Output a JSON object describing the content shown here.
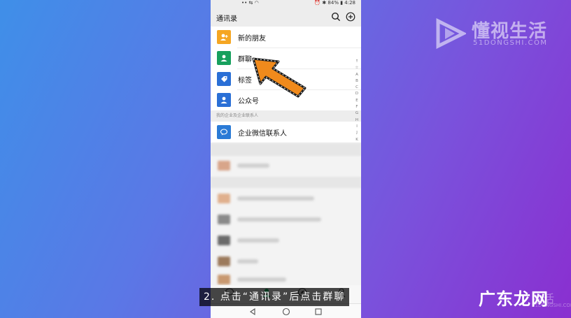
{
  "status_bar": {
    "left": "•• ⇆ ◠",
    "right": "⏰ ✱ 84% ▮ 4:28"
  },
  "header": {
    "title": "通讯录"
  },
  "contacts_menu": {
    "items": [
      {
        "label": "新的朋友",
        "icon": "add-friend-icon",
        "color": "#f5a623"
      },
      {
        "label": "群聊",
        "icon": "group-icon",
        "color": "#17a05d"
      },
      {
        "label": "标签",
        "icon": "tag-icon",
        "color": "#2a6fd6"
      },
      {
        "label": "公众号",
        "icon": "official-account-icon",
        "color": "#2a6fd6"
      }
    ]
  },
  "enterprise": {
    "section_header": "我的企业及企业联系人",
    "item": {
      "label": "企业微信联系人",
      "icon": "wecom-icon",
      "color": "#2a7ad6"
    }
  },
  "alphabet_index": [
    "↑",
    "☆",
    "A",
    "B",
    "C",
    "D",
    "E",
    "F",
    "G",
    "H",
    "I",
    "J",
    "K"
  ],
  "subtitle": "2. 点击“通讯录”后点击群聊",
  "watermark": {
    "name": "懂视生活",
    "domain": "51DONGSHI.COM"
  },
  "brand_corner": {
    "text": "广东龙网",
    "ghost": "生活",
    "ghost_sub": "51DONGSHI.COM"
  },
  "colors": {
    "accent_arrow": "#f08a1c",
    "wechat_green": "#07c160"
  }
}
